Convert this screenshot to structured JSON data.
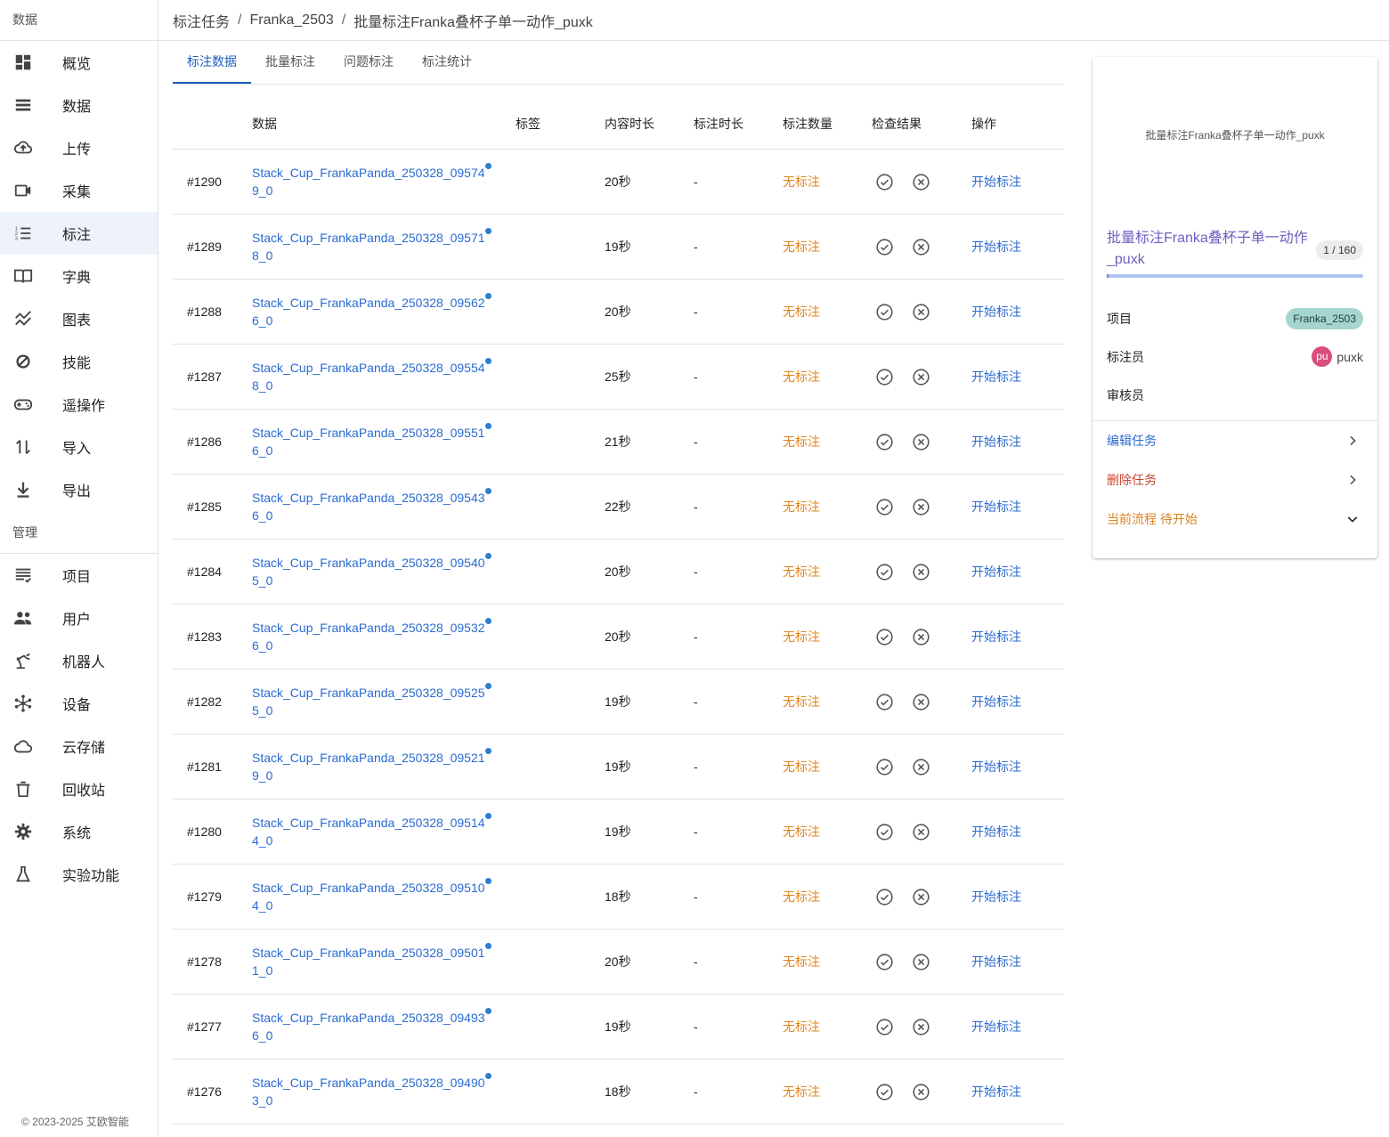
{
  "sidebar": {
    "section_data": "数据",
    "section_mgmt": "管理",
    "items_data": [
      {
        "label": "概览",
        "icon": "dashboard-icon"
      },
      {
        "label": "数据",
        "icon": "list-icon"
      },
      {
        "label": "上传",
        "icon": "cloud-upload-icon"
      },
      {
        "label": "采集",
        "icon": "video-camera-icon"
      },
      {
        "label": "标注",
        "icon": "list-numbered-icon",
        "active": true
      },
      {
        "label": "字典",
        "icon": "book-icon"
      },
      {
        "label": "图表",
        "icon": "chart-icon"
      },
      {
        "label": "技能",
        "icon": "skill-icon"
      },
      {
        "label": "遥操作",
        "icon": "gamepad-icon"
      },
      {
        "label": "导入",
        "icon": "import-icon"
      },
      {
        "label": "导出",
        "icon": "download-icon"
      }
    ],
    "items_mgmt": [
      {
        "label": "项目",
        "icon": "project-icon"
      },
      {
        "label": "用户",
        "icon": "users-icon"
      },
      {
        "label": "机器人",
        "icon": "robot-arm-icon"
      },
      {
        "label": "设备",
        "icon": "device-icon"
      },
      {
        "label": "云存储",
        "icon": "cloud-icon"
      },
      {
        "label": "回收站",
        "icon": "trash-icon"
      },
      {
        "label": "系统",
        "icon": "gear-icon"
      },
      {
        "label": "实验功能",
        "icon": "flask-icon"
      }
    ],
    "copyright": "© 2023-2025 艾欧智能"
  },
  "breadcrumb": [
    "标注任务",
    "Franka_2503",
    "批量标注Franka叠杯子单一动作_puxk"
  ],
  "tabs": [
    {
      "label": "标注数据",
      "active": true
    },
    {
      "label": "批量标注"
    },
    {
      "label": "问题标注"
    },
    {
      "label": "标注统计"
    }
  ],
  "table": {
    "headers": {
      "id": "",
      "data": "数据",
      "tag": "标签",
      "duration": "内容时长",
      "label_time": "标注时长",
      "count": "标注数量",
      "check": "检查结果",
      "op": "操作"
    },
    "rows": [
      {
        "id": "#1290",
        "data": "Stack_Cup_FrankaPanda_250328_095749_0",
        "duration": "20秒",
        "label_time": "-",
        "count": "无标注",
        "op": "开始标注"
      },
      {
        "id": "#1289",
        "data": "Stack_Cup_FrankaPanda_250328_095718_0",
        "duration": "19秒",
        "label_time": "-",
        "count": "无标注",
        "op": "开始标注"
      },
      {
        "id": "#1288",
        "data": "Stack_Cup_FrankaPanda_250328_095626_0",
        "duration": "20秒",
        "label_time": "-",
        "count": "无标注",
        "op": "开始标注"
      },
      {
        "id": "#1287",
        "data": "Stack_Cup_FrankaPanda_250328_095548_0",
        "duration": "25秒",
        "label_time": "-",
        "count": "无标注",
        "op": "开始标注"
      },
      {
        "id": "#1286",
        "data": "Stack_Cup_FrankaPanda_250328_095516_0",
        "duration": "21秒",
        "label_time": "-",
        "count": "无标注",
        "op": "开始标注"
      },
      {
        "id": "#1285",
        "data": "Stack_Cup_FrankaPanda_250328_095436_0",
        "duration": "22秒",
        "label_time": "-",
        "count": "无标注",
        "op": "开始标注"
      },
      {
        "id": "#1284",
        "data": "Stack_Cup_FrankaPanda_250328_095405_0",
        "duration": "20秒",
        "label_time": "-",
        "count": "无标注",
        "op": "开始标注"
      },
      {
        "id": "#1283",
        "data": "Stack_Cup_FrankaPanda_250328_095326_0",
        "duration": "20秒",
        "label_time": "-",
        "count": "无标注",
        "op": "开始标注"
      },
      {
        "id": "#1282",
        "data": "Stack_Cup_FrankaPanda_250328_095255_0",
        "duration": "19秒",
        "label_time": "-",
        "count": "无标注",
        "op": "开始标注"
      },
      {
        "id": "#1281",
        "data": "Stack_Cup_FrankaPanda_250328_095219_0",
        "duration": "19秒",
        "label_time": "-",
        "count": "无标注",
        "op": "开始标注"
      },
      {
        "id": "#1280",
        "data": "Stack_Cup_FrankaPanda_250328_095144_0",
        "duration": "19秒",
        "label_time": "-",
        "count": "无标注",
        "op": "开始标注"
      },
      {
        "id": "#1279",
        "data": "Stack_Cup_FrankaPanda_250328_095104_0",
        "duration": "18秒",
        "label_time": "-",
        "count": "无标注",
        "op": "开始标注"
      },
      {
        "id": "#1278",
        "data": "Stack_Cup_FrankaPanda_250328_095011_0",
        "duration": "20秒",
        "label_time": "-",
        "count": "无标注",
        "op": "开始标注"
      },
      {
        "id": "#1277",
        "data": "Stack_Cup_FrankaPanda_250328_094936_0",
        "duration": "19秒",
        "label_time": "-",
        "count": "无标注",
        "op": "开始标注"
      },
      {
        "id": "#1276",
        "data": "Stack_Cup_FrankaPanda_250328_094903_0",
        "duration": "18秒",
        "label_time": "-",
        "count": "无标注",
        "op": "开始标注"
      }
    ]
  },
  "panel": {
    "preview_text": "批量标注Franka叠杯子单一动作_puxk",
    "title": "批量标注Franka叠杯子单一动作_puxk",
    "pager": "1 / 160",
    "progress": 0.00625,
    "project_label": "项目",
    "project_value": "Franka_2503",
    "annotator_label": "标注员",
    "annotator_avatar": "pu",
    "annotator_name": "puxk",
    "reviewer_label": "审核员",
    "edit_task": "编辑任务",
    "delete_task": "删除任务",
    "current_flow": "当前流程 待开始"
  },
  "colors": {
    "accent": "#1f5fbf",
    "link": "#2a6bd1",
    "warning": "#e0841f",
    "danger": "#c6452f",
    "chip": "#a5d5cf",
    "avatar": "#d94e7a"
  }
}
